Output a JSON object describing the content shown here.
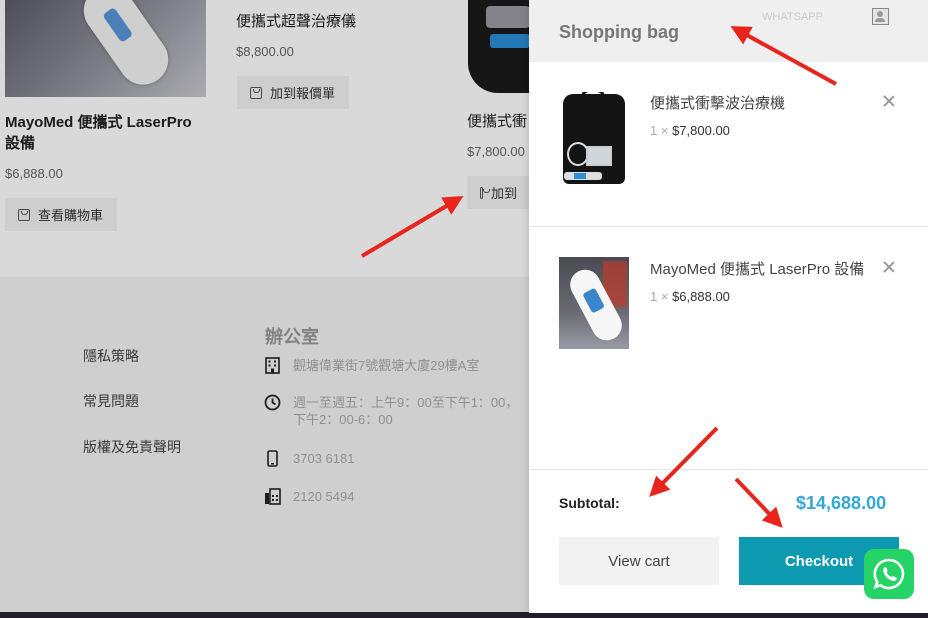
{
  "background": {
    "products": [
      {
        "name": "MayoMed 便攜式 LaserPro 設備",
        "price": "$6,888.00",
        "button_label": "查看購物車"
      },
      {
        "name": "便攜式超聲治療儀",
        "price": "$8,800.00",
        "button_label": "加到報價單"
      },
      {
        "name": "便攜式衝",
        "price": "$7,800.00",
        "button_label": "加到"
      }
    ],
    "footer": {
      "links": [
        "隱私策略",
        "常見問題",
        "版權及免責聲明"
      ],
      "office_title": "辦公室",
      "office_rows": [
        {
          "icon": "building-icon",
          "text": "觀塘偉業街7號觀塘大廈29樓A室"
        },
        {
          "icon": "clock-icon",
          "text": "週一至週五：上午9：00至下午1：00，下午2：00-6：00"
        },
        {
          "icon": "mobile-phone-icon",
          "text": "3703 6181"
        },
        {
          "icon": "fax-icon",
          "text": "2120 5494"
        }
      ]
    }
  },
  "cart": {
    "title": "Shopping bag",
    "header_ghost_text": "WHATSAPP",
    "items": [
      {
        "name": "便攜式衝擊波治療機",
        "quantity": "1",
        "times": "×",
        "price": "$7,800.00"
      },
      {
        "name": "MayoMed 便攜式 LaserPro 設備",
        "quantity": "1",
        "times": "×",
        "price": "$6,888.00"
      }
    ],
    "subtotal_label": "Subtotal:",
    "subtotal_value": "$14,688.00",
    "view_cart_label": "View cart",
    "checkout_label": "Checkout"
  },
  "colors": {
    "accent_price": "#33a8d4",
    "checkout_bg": "#0d99b0",
    "whatsapp": "#25d366",
    "annotation_arrow": "#e8241c"
  }
}
